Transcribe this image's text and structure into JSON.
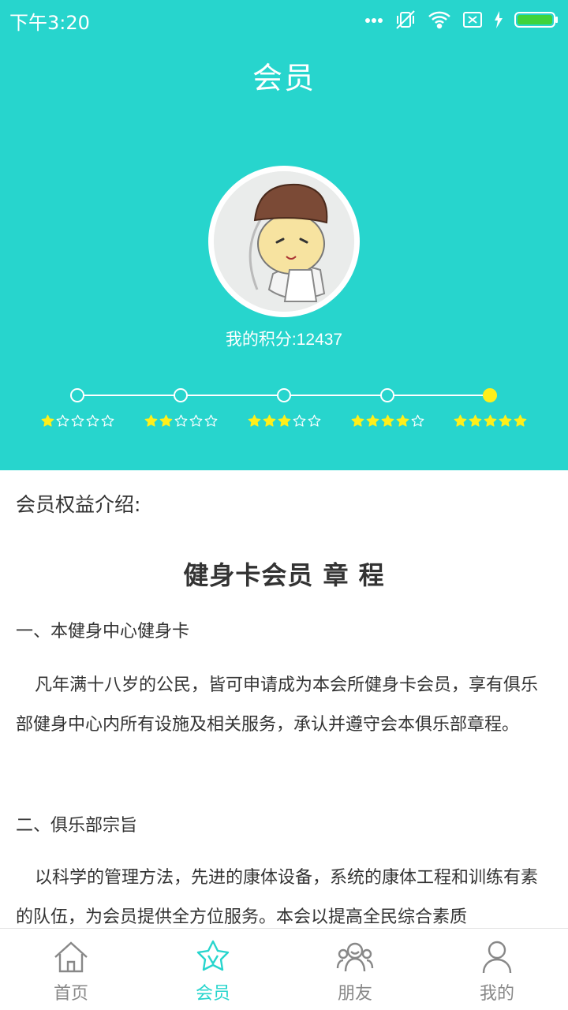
{
  "status_bar": {
    "time": "下午3:20",
    "icons": [
      "dots-icon",
      "vibrate-off-icon",
      "wifi-icon",
      "no-sim-icon",
      "charging-icon",
      "battery-icon"
    ]
  },
  "header": {
    "title": "会员",
    "avatar": "cartoon-character-avatar",
    "points_label": "我的积分:12437"
  },
  "levels": [
    {
      "stars": 1,
      "active": false
    },
    {
      "stars": 2,
      "active": false
    },
    {
      "stars": 3,
      "active": false
    },
    {
      "stars": 4,
      "active": false
    },
    {
      "stars": 5,
      "active": true
    }
  ],
  "colors": {
    "brand": "#27d5cd",
    "active_node": "#ffef1a",
    "star": "#ffef1a",
    "text": "#333333",
    "tab_inactive": "#888888"
  },
  "content": {
    "intro_label": "会员权益介绍:",
    "doc_title": "健身卡会员 章 程",
    "section1_title": "一、本健身中心健身卡",
    "section1_text": "凡年满十八岁的公民，皆可申请成为本会所健身卡会员，享有俱乐部健身中心内所有设施及相关服务，承认并遵守会本俱乐部章程。",
    "section2_title": "二、俱乐部宗旨",
    "section2_text": "以科学的管理方法，先进的康体设备，系统的康体工程和训练有素的队伍，为会员提供全方位服务。本会以提高全民综合素质"
  },
  "tabs": [
    {
      "label": "首页",
      "icon": "home-icon",
      "active": false
    },
    {
      "label": "会员",
      "icon": "member-star-icon",
      "active": true
    },
    {
      "label": "朋友",
      "icon": "friends-icon",
      "active": false
    },
    {
      "label": "我的",
      "icon": "profile-icon",
      "active": false
    }
  ]
}
